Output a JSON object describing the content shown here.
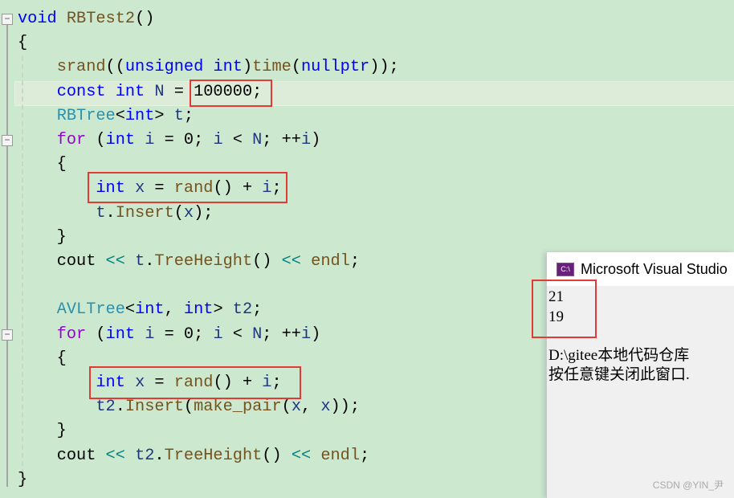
{
  "code": {
    "lines": [
      [
        [
          "void",
          "kw"
        ],
        [
          " ",
          ""
        ],
        [
          "RBTest2",
          "fn"
        ],
        [
          "()",
          ""
        ]
      ],
      [
        [
          "{",
          ""
        ]
      ],
      [
        [
          "    ",
          ""
        ],
        [
          "srand",
          "fn"
        ],
        [
          "((",
          ""
        ],
        [
          "unsigned",
          "kw"
        ],
        [
          " ",
          ""
        ],
        [
          "int",
          "kw"
        ],
        [
          ")",
          ""
        ],
        [
          "time",
          "fn"
        ],
        [
          "(",
          ""
        ],
        [
          "nullptr",
          "kw"
        ],
        [
          "));",
          ""
        ]
      ],
      [
        [
          "    ",
          ""
        ],
        [
          "const",
          "kw"
        ],
        [
          " ",
          ""
        ],
        [
          "int",
          "kw"
        ],
        [
          " ",
          ""
        ],
        [
          "N",
          "var"
        ],
        [
          " = ",
          ""
        ],
        [
          "100000",
          ""
        ],
        [
          ";",
          ""
        ]
      ],
      [
        [
          "    ",
          ""
        ],
        [
          "RBTree",
          "ty"
        ],
        [
          "<",
          ""
        ],
        [
          "int",
          "kw"
        ],
        [
          "> ",
          ""
        ],
        [
          "t",
          "var"
        ],
        [
          ";",
          ""
        ]
      ],
      [
        [
          "    ",
          ""
        ],
        [
          "for",
          "ctl"
        ],
        [
          " (",
          ""
        ],
        [
          "int",
          "kw"
        ],
        [
          " ",
          ""
        ],
        [
          "i",
          "var"
        ],
        [
          " = 0; ",
          ""
        ],
        [
          "i",
          "var"
        ],
        [
          " < ",
          ""
        ],
        [
          "N",
          "var"
        ],
        [
          "; ++",
          ""
        ],
        [
          "i",
          "var"
        ],
        [
          ")",
          ""
        ]
      ],
      [
        [
          "    {",
          ""
        ]
      ],
      [
        [
          "        ",
          ""
        ],
        [
          "int",
          "kw"
        ],
        [
          " ",
          ""
        ],
        [
          "x",
          "var"
        ],
        [
          " = ",
          ""
        ],
        [
          "rand",
          "fn"
        ],
        [
          "() + ",
          ""
        ],
        [
          "i",
          "var"
        ],
        [
          ";",
          ""
        ]
      ],
      [
        [
          "        ",
          ""
        ],
        [
          "t",
          "var"
        ],
        [
          ".",
          ""
        ],
        [
          "Insert",
          "fn"
        ],
        [
          "(",
          ""
        ],
        [
          "x",
          "var"
        ],
        [
          ");",
          ""
        ]
      ],
      [
        [
          "    }",
          ""
        ]
      ],
      [
        [
          "    ",
          ""
        ],
        [
          "cout",
          ""
        ],
        [
          " ",
          ""
        ],
        [
          "<<",
          "op"
        ],
        [
          " ",
          ""
        ],
        [
          "t",
          "var"
        ],
        [
          ".",
          ""
        ],
        [
          "TreeHeight",
          "fn"
        ],
        [
          "() ",
          ""
        ],
        [
          "<<",
          "op"
        ],
        [
          " ",
          ""
        ],
        [
          "endl",
          "fn"
        ],
        [
          ";",
          ""
        ]
      ],
      [],
      [
        [
          "    ",
          ""
        ],
        [
          "AVLTree",
          "ty"
        ],
        [
          "<",
          ""
        ],
        [
          "int",
          "kw"
        ],
        [
          ", ",
          ""
        ],
        [
          "int",
          "kw"
        ],
        [
          "> ",
          ""
        ],
        [
          "t2",
          "var"
        ],
        [
          ";",
          ""
        ]
      ],
      [
        [
          "    ",
          ""
        ],
        [
          "for",
          "ctl"
        ],
        [
          " (",
          ""
        ],
        [
          "int",
          "kw"
        ],
        [
          " ",
          ""
        ],
        [
          "i",
          "var"
        ],
        [
          " = 0; ",
          ""
        ],
        [
          "i",
          "var"
        ],
        [
          " < ",
          ""
        ],
        [
          "N",
          "var"
        ],
        [
          "; ++",
          ""
        ],
        [
          "i",
          "var"
        ],
        [
          ")",
          ""
        ]
      ],
      [
        [
          "    {",
          ""
        ]
      ],
      [
        [
          "        ",
          ""
        ],
        [
          "int",
          "kw"
        ],
        [
          " ",
          ""
        ],
        [
          "x",
          "var"
        ],
        [
          " = ",
          ""
        ],
        [
          "rand",
          "fn"
        ],
        [
          "() + ",
          ""
        ],
        [
          "i",
          "var"
        ],
        [
          ";",
          ""
        ]
      ],
      [
        [
          "        ",
          ""
        ],
        [
          "t2",
          "var"
        ],
        [
          ".",
          ""
        ],
        [
          "Insert",
          "fn"
        ],
        [
          "(",
          ""
        ],
        [
          "make_pair",
          "fn"
        ],
        [
          "(",
          ""
        ],
        [
          "x",
          "var"
        ],
        [
          ", ",
          ""
        ],
        [
          "x",
          "var"
        ],
        [
          "));",
          ""
        ]
      ],
      [
        [
          "    }",
          ""
        ]
      ],
      [
        [
          "    ",
          ""
        ],
        [
          "cout",
          ""
        ],
        [
          " ",
          ""
        ],
        [
          "<<",
          "op"
        ],
        [
          " ",
          ""
        ],
        [
          "t2",
          "var"
        ],
        [
          ".",
          ""
        ],
        [
          "TreeHeight",
          "fn"
        ],
        [
          "() ",
          ""
        ],
        [
          "<<",
          "op"
        ],
        [
          " ",
          ""
        ],
        [
          "endl",
          "fn"
        ],
        [
          ";",
          ""
        ]
      ],
      [
        [
          "}",
          ""
        ]
      ]
    ]
  },
  "console": {
    "title": "Microsoft Visual Studio",
    "icon_label": "C:\\",
    "output": [
      "21",
      "19",
      "",
      "D:\\gitee本地代码仓库",
      "按任意键关闭此窗口."
    ]
  },
  "watermark": "CSDN @YIN_尹",
  "colors": {
    "background": "#cce8cf",
    "highlight_box": "#e53935",
    "keyword": "#0000ff",
    "function": "#74531f",
    "type": "#2b91af"
  }
}
